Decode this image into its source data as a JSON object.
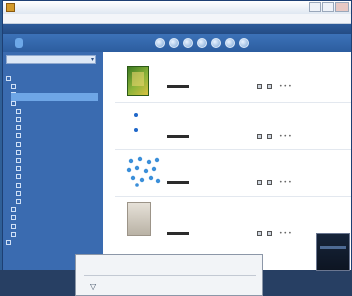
{
  "window": {
    "title": "",
    "buttons": [
      "",
      "",
      ""
    ]
  },
  "menu": [
    "",
    "",
    "",
    "",
    "",
    ""
  ],
  "address": {
    "path": "",
    "section": ""
  },
  "toolbar": {
    "tabs": [
      "",
      ""
    ],
    "icons": [
      "nav-circle-icon",
      "nav-circle-icon",
      "nav-circle-icon",
      "nav-circle-icon",
      "nav-circle-icon",
      "nav-circle-icon",
      "nav-circle-icon"
    ]
  },
  "sidebar": {
    "dropdown_value": "",
    "tree": [
      {
        "label": "",
        "level": 0
      },
      {
        "label": "",
        "level": 1
      },
      {
        "label": "",
        "level": 1
      },
      {
        "label": "",
        "level": 1,
        "selected": true
      },
      {
        "label": "",
        "level": 2
      },
      {
        "label": "",
        "level": 2
      },
      {
        "label": "",
        "level": 2
      },
      {
        "label": "",
        "level": 2
      },
      {
        "label": "",
        "level": 2
      },
      {
        "label": "",
        "level": 2
      },
      {
        "label": "",
        "level": 2
      },
      {
        "label": "",
        "level": 2
      },
      {
        "label": "",
        "level": 2
      },
      {
        "label": "",
        "level": 2
      },
      {
        "label": "",
        "level": 2
      },
      {
        "label": "",
        "level": 2
      },
      {
        "label": "",
        "level": 1
      },
      {
        "label": "",
        "level": 1
      },
      {
        "label": "",
        "level": 1
      },
      {
        "label": "",
        "level": 1
      },
      {
        "label": "",
        "level": 0
      }
    ]
  },
  "items": [
    {
      "title": "",
      "thumb": "book"
    },
    {
      "title": "",
      "thumb": "dot"
    },
    {
      "title": "",
      "thumb": "molecules"
    },
    {
      "title": "",
      "thumb": "photo"
    }
  ],
  "dialog": {
    "title": "",
    "icon": "filter-icon"
  },
  "side_thumb": {
    "label": ""
  },
  "colors": {
    "accent": "#2c5d9f",
    "sidebar": "#3a6bb0",
    "link": "#1b5fb8",
    "selected": "#6ea6e6"
  }
}
